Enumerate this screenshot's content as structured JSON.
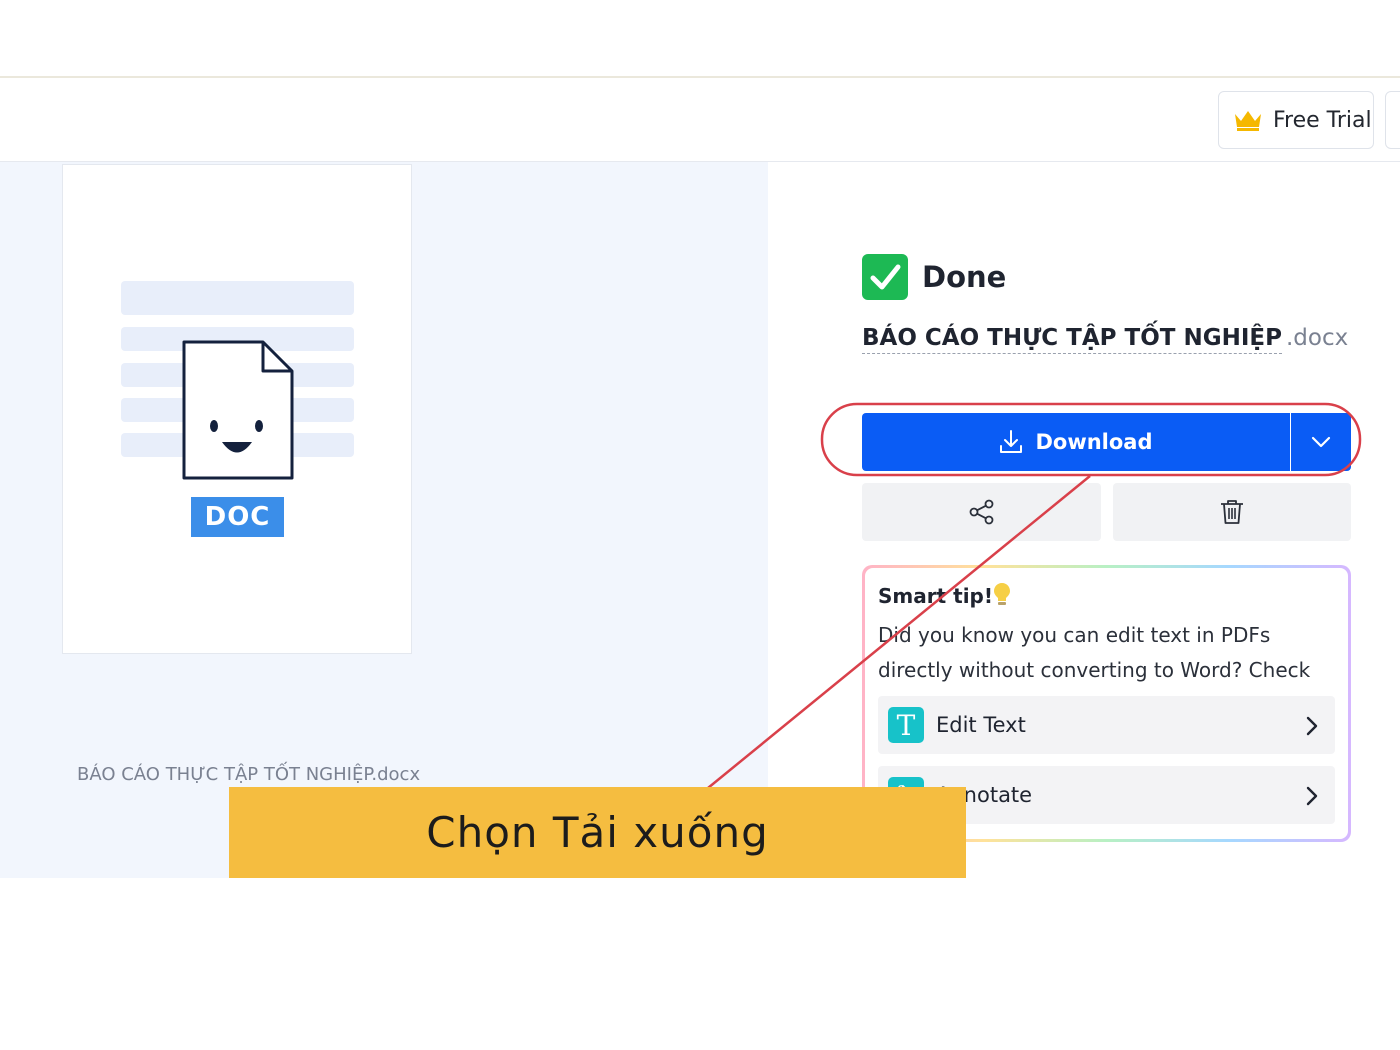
{
  "header": {
    "free_trial_label": "Free Trial",
    "crown_icon": "crown-icon",
    "crown_color": "#f5b800"
  },
  "preview": {
    "badge": "DOC",
    "caption": "BÁO CÁO THỰC TẬP TỐT NGHIỆP.docx"
  },
  "result": {
    "status": "Done",
    "status_color": "#1db954",
    "filename": "BÁO CÁO THỰC TẬP TỐT NGHIỆP",
    "extension": ".docx",
    "download_label": "Download",
    "download_color": "#0a5cf5"
  },
  "smart_tip": {
    "title": "Smart tip!",
    "body": "Did you know you can edit text in PDFs directly without converting to Word? Check out:",
    "items": [
      {
        "label": "Edit Text",
        "icon": "edit-text-icon"
      },
      {
        "label": "Annotate",
        "icon": "annotate-icon"
      }
    ]
  },
  "annotation": {
    "caption": "Chọn Tải xuống",
    "caption_bg": "#f5bd40",
    "highlight_color": "#d9404a"
  }
}
